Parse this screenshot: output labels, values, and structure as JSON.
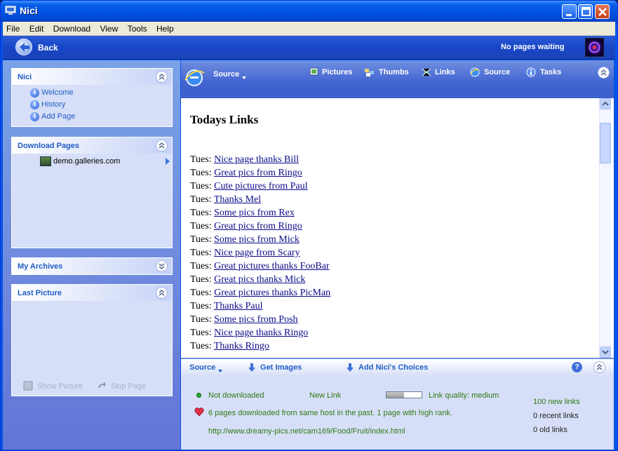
{
  "window": {
    "title": "Nici"
  },
  "menu": [
    "File",
    "Edit",
    "Download",
    "View",
    "Tools",
    "Help"
  ],
  "nav": {
    "back_label": "Back",
    "status": "No pages waiting"
  },
  "left": {
    "nici": {
      "title": "Nici",
      "items": [
        "Welcome",
        "History",
        "Add Page"
      ]
    },
    "download": {
      "title": "Download Pages",
      "items": [
        "demo.galleries.com"
      ]
    },
    "archives": {
      "title": "My Archives"
    },
    "last_picture": {
      "title": "Last Picture",
      "show_picture": "Show Picture",
      "skip_page": "Skip Page"
    }
  },
  "toolbar": {
    "source_label": "Source",
    "items": [
      "Pictures",
      "Thumbs",
      "Links",
      "Source",
      "Tasks"
    ]
  },
  "content": {
    "heading": "Todays Links",
    "day_prefix": "Tues:",
    "links": [
      "Nice page thanks Bill",
      "Great pics from Ringo",
      "Cute pictures from Paul",
      "Thanks Mel",
      "Some pics from Rex",
      "Great pics from Ringo",
      "Some pics from Mick",
      "Nice page from Scary",
      "Great pictures thanks FooBar",
      "Great pics thanks Mick",
      "Great pictures thanks PicMan",
      "Thanks Paul",
      "Some pics from Posh",
      "Nice page thanks Ringo",
      "Thanks Ringo"
    ]
  },
  "bottom": {
    "source_label": "Source",
    "get_images": "Get Images",
    "add_choices": "Add Nici's Choices",
    "status": "Not downloaded",
    "link_type": "New Link",
    "link_quality": "Link quality: medium",
    "quality_fraction": 0.5,
    "history_note": "6 pages downloaded from same host in the past. 1 page  with high rank.",
    "url": "http://www.dreamy-pics.net/cam169/Food/Fruit/index.html",
    "new_links": "100 new links",
    "recent_links": "0 recent links",
    "old_links": "0 old links"
  },
  "colors": {
    "accent": "#215dc6",
    "title_bar": "#0054e3",
    "green_text": "#2f7a14"
  }
}
